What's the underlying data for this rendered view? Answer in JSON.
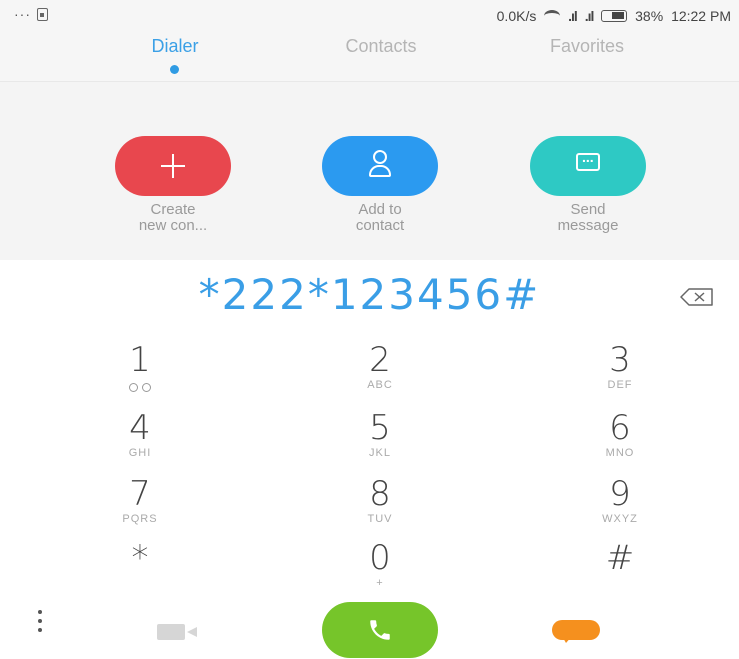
{
  "status_bar": {
    "left_indicator": "···",
    "net_speed": "0.0K/s",
    "signal_1": ".ıl",
    "signal_2": ".ıl",
    "battery_percent": "38%",
    "time": "12:22 PM"
  },
  "tabs": [
    {
      "label": "Dialer",
      "active": true
    },
    {
      "label": "Contacts",
      "active": false
    },
    {
      "label": "Favorites",
      "active": false
    }
  ],
  "actions": [
    {
      "label": "Create\nnew con...",
      "icon": "plus-icon",
      "color": "#e8474e"
    },
    {
      "label": "Add to\ncontact",
      "icon": "person-icon",
      "color": "#2b9af0"
    },
    {
      "label": "Send\nmessage",
      "icon": "message-icon",
      "color": "#2ec9c4"
    }
  ],
  "dial_number": "*222*123456#",
  "keypad": [
    {
      "digit": "1",
      "letters": ""
    },
    {
      "digit": "2",
      "letters": "ABC"
    },
    {
      "digit": "3",
      "letters": "DEF"
    },
    {
      "digit": "4",
      "letters": "GHI"
    },
    {
      "digit": "5",
      "letters": "JKL"
    },
    {
      "digit": "6",
      "letters": "MNO"
    },
    {
      "digit": "7",
      "letters": "PQRS"
    },
    {
      "digit": "8",
      "letters": "TUV"
    },
    {
      "digit": "9",
      "letters": "WXYZ"
    },
    {
      "digit": "*",
      "letters": ""
    },
    {
      "digit": "0",
      "letters": "+"
    },
    {
      "digit": "#",
      "letters": ""
    }
  ],
  "colors": {
    "accent": "#3ba0e6",
    "call": "#76c52a",
    "chat": "#f5901e"
  }
}
